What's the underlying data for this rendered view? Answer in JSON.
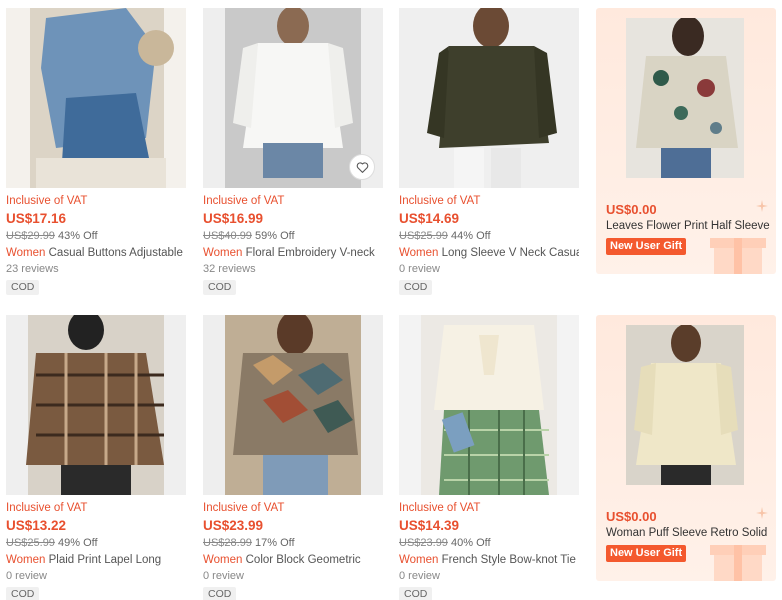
{
  "products": [
    {
      "vat": "Inclusive of VAT",
      "price": "US$17.16",
      "orig": "US$29.99",
      "off": "43% Off",
      "category": "Women",
      "name": "Casual Buttons Adjustable",
      "reviews": "23 reviews",
      "cod": "COD"
    },
    {
      "vat": "Inclusive of VAT",
      "price": "US$16.99",
      "orig": "US$40.99",
      "off": "59% Off",
      "category": "Women",
      "name": "Floral Embroidery V-neck",
      "reviews": "32 reviews",
      "cod": "COD"
    },
    {
      "vat": "Inclusive of VAT",
      "price": "US$14.69",
      "orig": "US$25.99",
      "off": "44% Off",
      "category": "Women",
      "name": "Long Sleeve V Neck Casual",
      "reviews": "0 review",
      "cod": "COD"
    },
    {
      "vat": "Inclusive of VAT",
      "price": "US$13.22",
      "orig": "US$25.99",
      "off": "49% Off",
      "category": "Women",
      "name": "Plaid Print Lapel Long",
      "reviews": "0 review",
      "cod": "COD"
    },
    {
      "vat": "Inclusive of VAT",
      "price": "US$23.99",
      "orig": "US$28.99",
      "off": "17% Off",
      "category": "Women",
      "name": "Color Block Geometric",
      "reviews": "0 review",
      "cod": "COD"
    },
    {
      "vat": "Inclusive of VAT",
      "price": "US$14.39",
      "orig": "US$23.99",
      "off": "40% Off",
      "category": "Women",
      "name": "French Style Bow-knot Tie",
      "reviews": "0 review",
      "cod": "COD"
    }
  ],
  "gifts": [
    {
      "price": "US$0.00",
      "name": "Leaves Flower Print Half Sleeve",
      "badge": "New User Gift"
    },
    {
      "price": "US$0.00",
      "name": "Woman Puff Sleeve Retro Solid",
      "badge": "New User Gift"
    }
  ],
  "icons": {
    "wishlist": "heart-icon",
    "gift_box": "gift-box-icon"
  },
  "colors": {
    "accent": "#e8502f",
    "badge": "#f4592e",
    "gift_bg": "#ffe9dd"
  }
}
